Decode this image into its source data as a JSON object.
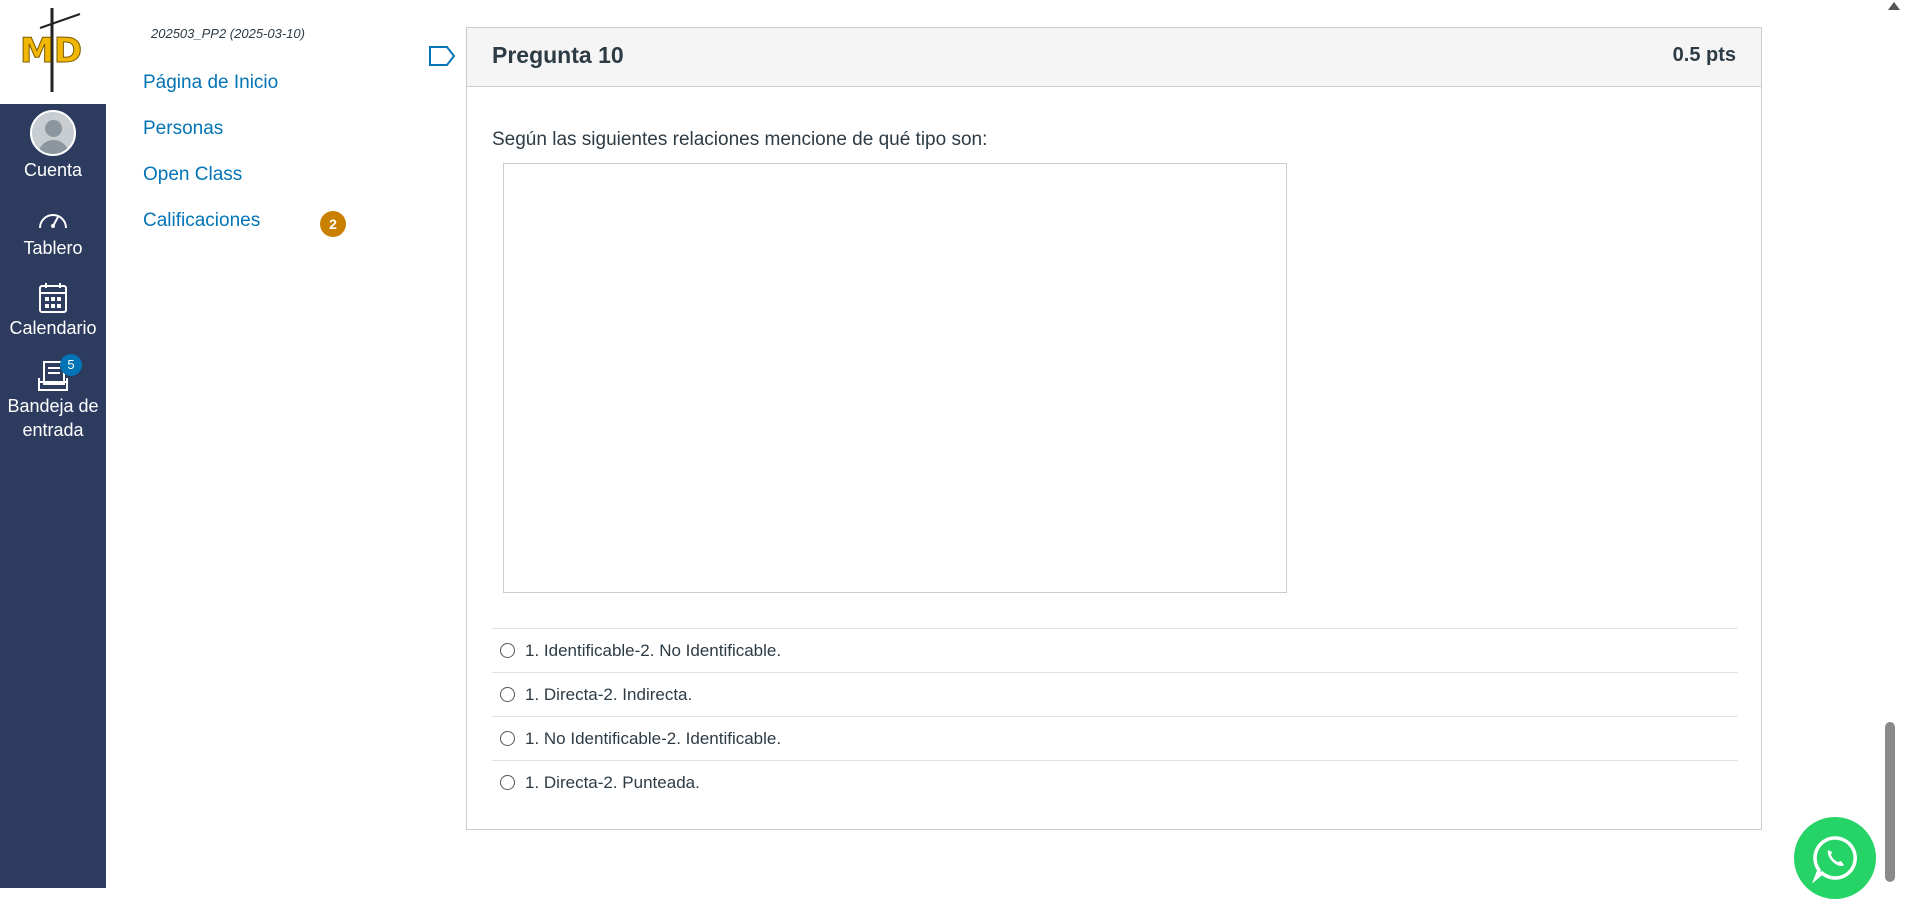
{
  "global_nav": {
    "logo_text": "MD",
    "items": [
      {
        "label": "Cuenta",
        "icon": "avatar"
      },
      {
        "label": "Tablero",
        "icon": "dashboard-icon"
      },
      {
        "label": "Calendario",
        "icon": "calendar-icon"
      },
      {
        "label": "Bandeja de entrada",
        "icon": "inbox-icon",
        "badge": "5"
      }
    ]
  },
  "course_nav": {
    "breadcrumb": "202503_PP2 (2025-03-10)",
    "links": [
      {
        "label": "Página de Inicio"
      },
      {
        "label": "Personas"
      },
      {
        "label": "Open Class"
      },
      {
        "label": "Calificaciones",
        "badge": "2"
      }
    ]
  },
  "question": {
    "title": "Pregunta 10",
    "points": "0.5 pts",
    "text": "Según las siguientes relaciones mencione de qué tipo son:",
    "answers": [
      "1. Identificable-2. No Identificable.",
      "1. Directa-2. Indirecta.",
      "1. No Identificable-2. Identificable.",
      "1. Directa-2. Punteada."
    ]
  },
  "colors": {
    "nav_bg": "#2d3b5e",
    "link": "#0374b5",
    "badge_orange": "#c98000",
    "badge_blue": "#0374b5",
    "whatsapp": "#25d366"
  }
}
